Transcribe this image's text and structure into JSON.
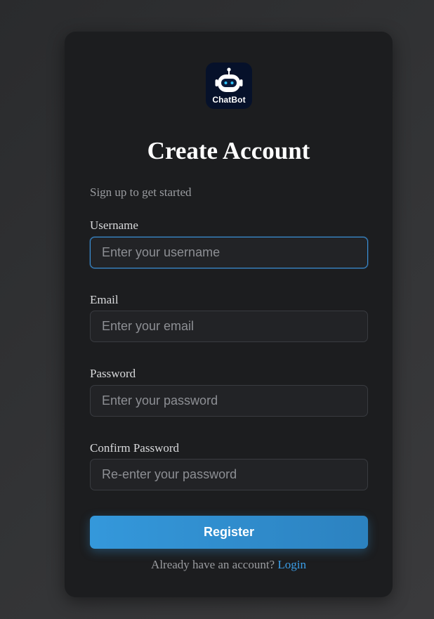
{
  "brand": {
    "logo_text": "ChatBot",
    "logo_bg": "#06112a",
    "icon": "robot-icon"
  },
  "title": "Create Account",
  "subtitle": "Sign up to get started",
  "fields": [
    {
      "label": "Username",
      "placeholder": "Enter your username",
      "value": "",
      "focused": true
    },
    {
      "label": "Email",
      "placeholder": "Enter your email",
      "value": "",
      "focused": false
    },
    {
      "label": "Password",
      "placeholder": "Enter your password",
      "value": "",
      "focused": false
    },
    {
      "label": "Confirm Password",
      "placeholder": "Re-enter your password",
      "value": "",
      "focused": false
    }
  ],
  "register_label": "Register",
  "footer": {
    "text": "Already have an account?",
    "link_label": "Login"
  },
  "colors": {
    "accent": "#3498db",
    "focus_border": "#3a8fd6",
    "link": "#3a9ee8",
    "card_bg": "#1c1d1f",
    "input_bg": "#222326"
  }
}
